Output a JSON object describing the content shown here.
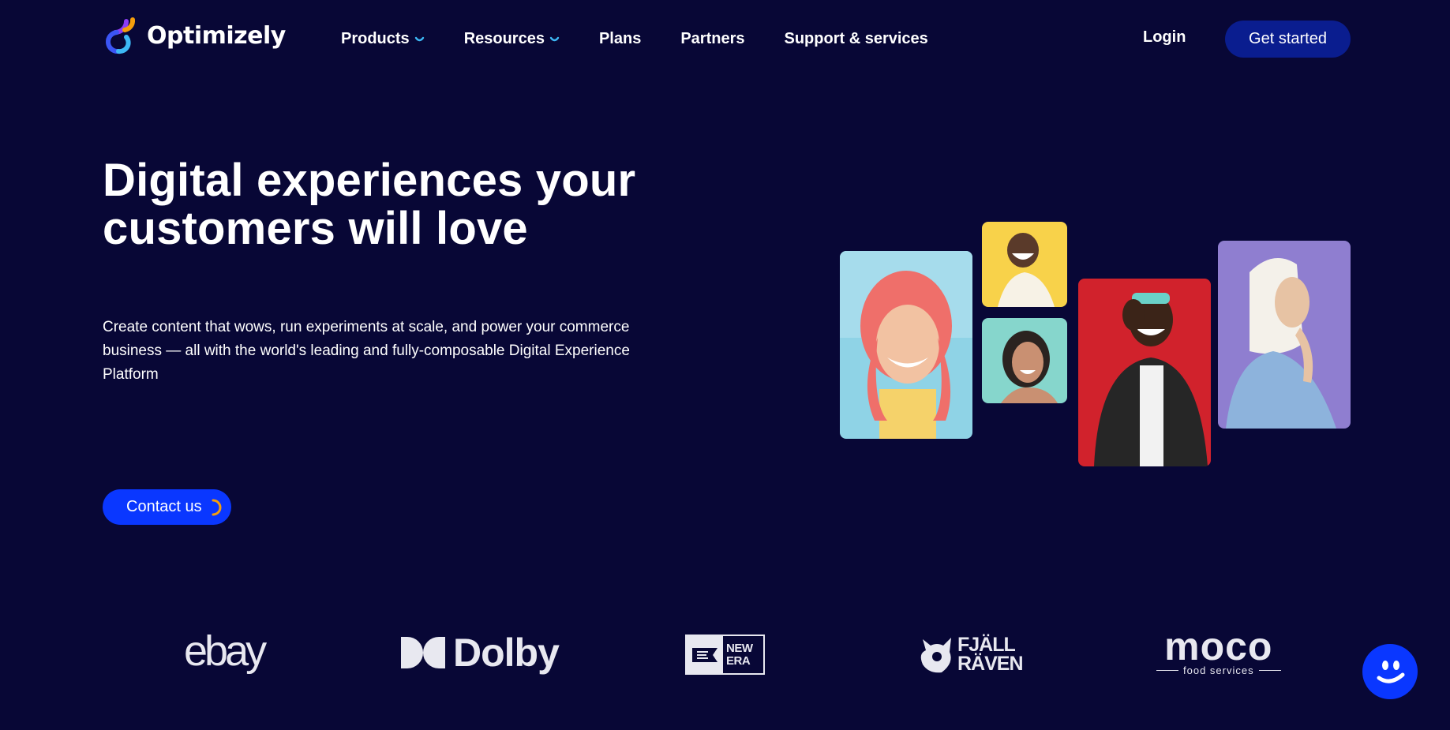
{
  "header": {
    "logo": {
      "name": "Optimizely"
    },
    "nav": [
      {
        "label": "Products",
        "has_dropdown": true
      },
      {
        "label": "Resources",
        "has_dropdown": true
      },
      {
        "label": "Plans",
        "has_dropdown": false
      },
      {
        "label": "Partners",
        "has_dropdown": false
      },
      {
        "label": "Support & services",
        "has_dropdown": false
      }
    ],
    "login_label": "Login",
    "cta_label": "Get started"
  },
  "hero": {
    "title_line1": "Digital experiences your",
    "title_line2": "customers will love",
    "subtitle": "Create content that wows, run experiments at scale, and power your commerce business — all with the world's leading and fully-composable Digital Experience Platform",
    "contact_label": "Contact us",
    "contact_icon": "loading-arc-icon"
  },
  "logos": {
    "ebay": "ebay",
    "dolby": "Dolby",
    "new_era_line1": "NEW",
    "new_era_line2": "ERA",
    "fjallraven_line1": "FJÄLL",
    "fjallraven_line2": "RÄVEN",
    "moco": "moco",
    "moco_sub": "food services"
  },
  "chat_widget": {
    "icon": "smiley-face-icon"
  },
  "colors": {
    "background": "#080736",
    "primary_button": "#0a37ff",
    "secondary_button": "#0a1d8f",
    "chevron": "#3db8f5",
    "accent_orange": "#f59e0b"
  }
}
